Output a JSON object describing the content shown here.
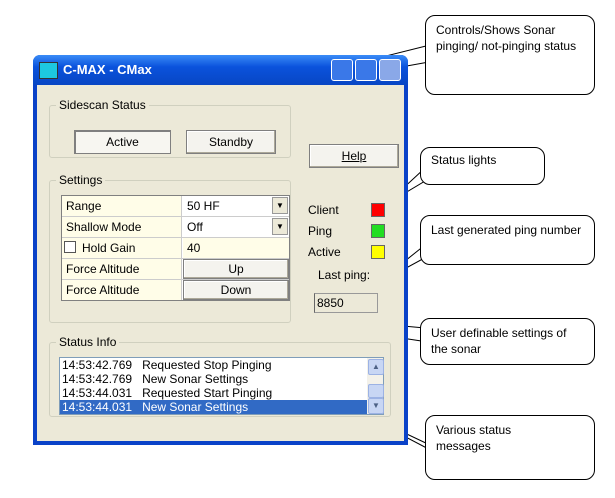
{
  "window": {
    "title": "C-MAX - CMax"
  },
  "sidescan": {
    "legend": "Sidescan Status",
    "active_label": "Active",
    "standby_label": "Standby"
  },
  "help_label": "Help",
  "settings": {
    "legend": "Settings",
    "rows": [
      {
        "label": "Range",
        "value": "50 HF",
        "type": "dropdown"
      },
      {
        "label": "Shallow Mode",
        "value": "Off",
        "type": "dropdown"
      },
      {
        "label": "Hold Gain",
        "value": "40",
        "type": "checkbox"
      },
      {
        "label": "Force Altitude",
        "value": "Up",
        "type": "button"
      },
      {
        "label": "Force Altitude",
        "value": "Down",
        "type": "button"
      }
    ]
  },
  "lights": [
    {
      "label": "Client",
      "color": "#ff0000"
    },
    {
      "label": "Ping",
      "color": "#22dd22"
    },
    {
      "label": "Active",
      "color": "#ffff00"
    }
  ],
  "last_ping": {
    "label": "Last ping:",
    "value": "8850"
  },
  "status_info": {
    "legend": "Status Info",
    "messages": [
      {
        "time": "14:53:42.769",
        "text": "Requested Stop Pinging"
      },
      {
        "time": "14:53:42.769",
        "text": "New Sonar Settings"
      },
      {
        "time": "14:53:44.031",
        "text": "Requested Start Pinging"
      },
      {
        "time": "14:53:44.031",
        "text": "New Sonar Settings",
        "selected": true
      }
    ]
  },
  "callouts": [
    "Controls/Shows Sonar pinging/ not-pinging status",
    "Status lights",
    "Last generated ping number",
    "User definable settings of the sonar",
    "Various status messages"
  ]
}
